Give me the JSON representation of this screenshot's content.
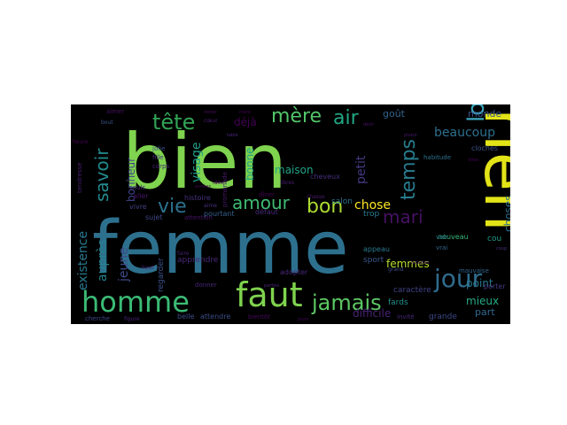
{
  "background_color": "#000000",
  "page_color": "#ffffff",
  "words": [
    {
      "text": "bien",
      "color": "#7fd34e"
    },
    {
      "text": "femme",
      "color": "#2d708e"
    },
    {
      "text": "rien",
      "color": "#e3e418"
    },
    {
      "text": "homme",
      "color": "#3bbb75"
    },
    {
      "text": "faut",
      "color": "#7fd34e"
    },
    {
      "text": "jamais",
      "color": "#5cc863"
    },
    {
      "text": "jour",
      "color": "#2f6c8e"
    },
    {
      "text": "lorsqu",
      "color": "#3ba7c0"
    },
    {
      "text": "tête",
      "color": "#31a354"
    },
    {
      "text": "mère",
      "color": "#52c569"
    },
    {
      "text": "air",
      "color": "#22a884"
    },
    {
      "text": "vie",
      "color": "#2c728e"
    },
    {
      "text": "amour",
      "color": "#3fbc73"
    },
    {
      "text": "bon",
      "color": "#addc30"
    },
    {
      "text": "temps",
      "color": "#287c8e"
    },
    {
      "text": "mari",
      "color": "#471164"
    },
    {
      "text": "savoir",
      "color": "#238a8d"
    },
    {
      "text": "beaucoup",
      "color": "#2d708e"
    },
    {
      "text": "chose",
      "color": "#fde725"
    },
    {
      "text": "existence",
      "color": "#2a788e"
    },
    {
      "text": "auprès",
      "color": "#26828e"
    },
    {
      "text": "visage",
      "color": "#1f9e89"
    },
    {
      "text": "jeune",
      "color": "#3e4a89"
    },
    {
      "text": "maison",
      "color": "#20a486"
    },
    {
      "text": "bonne",
      "color": "#1fa187"
    },
    {
      "text": "petit",
      "color": "#443983"
    },
    {
      "text": "choses",
      "color": "#2e6e8e"
    },
    {
      "text": "femmes",
      "color": "#b5de2b"
    },
    {
      "text": "point",
      "color": "#2a788e"
    },
    {
      "text": "mieux",
      "color": "#25ab82"
    },
    {
      "text": "part",
      "color": "#31688e"
    },
    {
      "text": "difficile",
      "color": "#482374"
    },
    {
      "text": "monde",
      "color": "#3a548c"
    },
    {
      "text": "déjà",
      "color": "#440154"
    },
    {
      "text": "goût",
      "color": "#33638d"
    },
    {
      "text": "bonheur",
      "color": "#404688"
    },
    {
      "text": "apprendre",
      "color": "#482878"
    },
    {
      "text": "sport",
      "color": "#39568c"
    },
    {
      "text": "caractère",
      "color": "#414487"
    },
    {
      "text": "trop",
      "color": "#287d8e"
    },
    {
      "text": "regarder",
      "color": "#3b528b"
    },
    {
      "text": "grande",
      "color": "#3e4989"
    },
    {
      "text": "salon",
      "color": "#2c728e"
    },
    {
      "text": "fards",
      "color": "#21918c"
    },
    {
      "text": "cou",
      "color": "#1e9b8a"
    },
    {
      "text": "nouveau",
      "color": "#35b779"
    },
    {
      "text": "porter",
      "color": "#453781"
    },
    {
      "text": "pourtant",
      "color": "#355f8d"
    },
    {
      "text": "défaut",
      "color": "#472c7a"
    },
    {
      "text": "histoire",
      "color": "#46327e"
    },
    {
      "text": "cheveux",
      "color": "#462f7e"
    },
    {
      "text": "dîner",
      "color": "#440154"
    },
    {
      "text": "promenade",
      "color": "#481a6c"
    },
    {
      "text": "belle",
      "color": "#3e4c8a"
    },
    {
      "text": "attendre",
      "color": "#3c4f8a"
    },
    {
      "text": "bientôt",
      "color": "#46085c"
    },
    {
      "text": "adopter",
      "color": "#482979"
    },
    {
      "text": "appeau",
      "color": "#2a788e"
    },
    {
      "text": "sujet",
      "color": "#3f4889"
    },
    {
      "text": "attention",
      "color": "#481567"
    },
    {
      "text": "aller",
      "color": "#481467"
    },
    {
      "text": "vivre",
      "color": "#423f85"
    },
    {
      "text": "fille",
      "color": "#46327e"
    },
    {
      "text": "jolie",
      "color": "#3d4e8a"
    },
    {
      "text": "corps",
      "color": "#482576"
    },
    {
      "text": "seuls",
      "color": "#472d7b"
    },
    {
      "text": "cloches",
      "color": "#3b528b"
    },
    {
      "text": "habitude",
      "color": "#2d708e"
    },
    {
      "text": "mauvaise",
      "color": "#32648e"
    },
    {
      "text": "vrai",
      "color": "#31688e"
    },
    {
      "text": "voir",
      "color": "#2a768e"
    },
    {
      "text": "invité",
      "color": "#482878"
    },
    {
      "text": "cherche",
      "color": "#3f4788"
    },
    {
      "text": "donner",
      "color": "#482576"
    },
    {
      "text": "aime",
      "color": "#46307e"
    },
    {
      "text": "chasse",
      "color": "#481a6c"
    },
    {
      "text": "heure",
      "color": "#440154"
    },
    {
      "text": "faire",
      "color": "#482173"
    },
    {
      "text": "grand",
      "color": "#3d4d8a"
    },
    {
      "text": "aimer",
      "color": "#440f5d"
    },
    {
      "text": "bout",
      "color": "#3b528b"
    },
    {
      "text": "figure",
      "color": "#482273"
    },
    {
      "text": "idée",
      "color": "#46085c"
    },
    {
      "text": "rester",
      "color": "#470d60"
    },
    {
      "text": "libres",
      "color": "#481d6f"
    },
    {
      "text": "parfois",
      "color": "#482979"
    },
    {
      "text": "cœur",
      "color": "#481b6d"
    },
    {
      "text": "désir",
      "color": "#471063"
    },
    {
      "text": "années",
      "color": "#46075a"
    },
    {
      "text": "mère",
      "color": "#440256"
    },
    {
      "text": "table",
      "color": "#482576"
    },
    {
      "text": "plaisir",
      "color": "#481769"
    },
    {
      "text": "jours",
      "color": "#450559"
    },
    {
      "text": "haut",
      "color": "#482374"
    },
    {
      "text": "dites",
      "color": "#440154"
    },
    {
      "text": "lunettes",
      "color": "#481668"
    },
    {
      "text": "coup",
      "color": "#472e7c"
    },
    {
      "text": "tendresse",
      "color": "#481d6f"
    }
  ]
}
